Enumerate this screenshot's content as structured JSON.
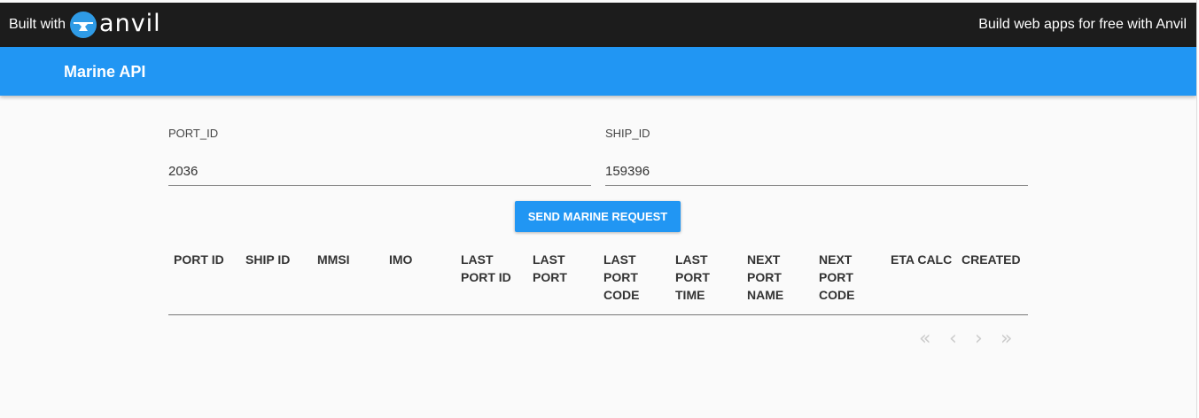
{
  "banner": {
    "built_with_label": "Built with",
    "logo_word": "anvil",
    "promo_link": "Build web apps for free with Anvil"
  },
  "header": {
    "title": "Marine API"
  },
  "form": {
    "port_id": {
      "label": "PORT_ID",
      "value": "2036"
    },
    "ship_id": {
      "label": "SHIP_ID",
      "value": "159396"
    },
    "submit_label": "SEND MARINE REQUEST"
  },
  "table": {
    "columns": [
      "PORT ID",
      "SHIP ID",
      "MMSI",
      "IMO",
      "LAST PORT ID",
      "LAST PORT",
      "LAST PORT CODE",
      "LAST PORT TIME",
      "NEXT PORT NAME",
      "NEXT PORT CODE",
      "ETA CALC",
      "CREATED"
    ],
    "rows": []
  },
  "pagination": {
    "first": "«",
    "prev": "‹",
    "next": "›",
    "last": "»"
  },
  "colors": {
    "banner_bg": "#1c1c1c",
    "accent": "#2196f3",
    "page_bg": "#fafafa"
  }
}
